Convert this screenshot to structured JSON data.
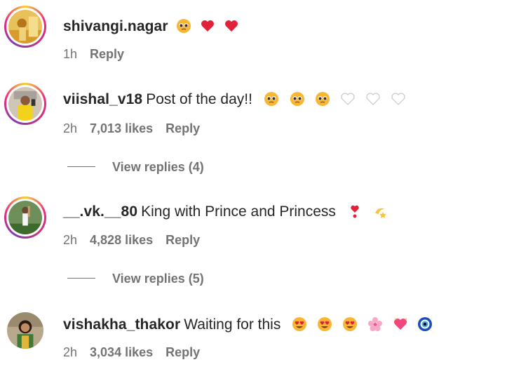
{
  "comments": [
    {
      "username": "shivangi.nagar",
      "text": "",
      "emojis": [
        "pleading-face",
        "red-heart",
        "red-heart"
      ],
      "time": "1h",
      "likes": "",
      "reply_label": "Reply"
    },
    {
      "username": "viishal_v18",
      "text": "Post of the day!!",
      "emojis": [
        "pleading-face",
        "pleading-face",
        "pleading-face",
        "white-heart",
        "white-heart",
        "white-heart"
      ],
      "time": "2h",
      "likes": "7,013 likes",
      "reply_label": "Reply",
      "view_replies": "View replies (4)"
    },
    {
      "username": "__.vk.__80",
      "text": "King with Prince and Princess",
      "emojis": [
        "heart-exclamation",
        "dizzy"
      ],
      "time": "2h",
      "likes": "4,828 likes",
      "reply_label": "Reply",
      "view_replies": "View replies (5)"
    },
    {
      "username": "vishakha_thakor",
      "text": "Waiting for this",
      "emojis": [
        "heart-eyes",
        "heart-eyes",
        "heart-eyes",
        "cherry-blossom",
        "sparkling-heart",
        "nazar-amulet"
      ],
      "time": "2h",
      "likes": "3,034 likes",
      "reply_label": "Reply"
    }
  ],
  "colors": {
    "text_primary": "#262626",
    "text_secondary": "#737373",
    "story_ring": "#ee2a7b"
  }
}
